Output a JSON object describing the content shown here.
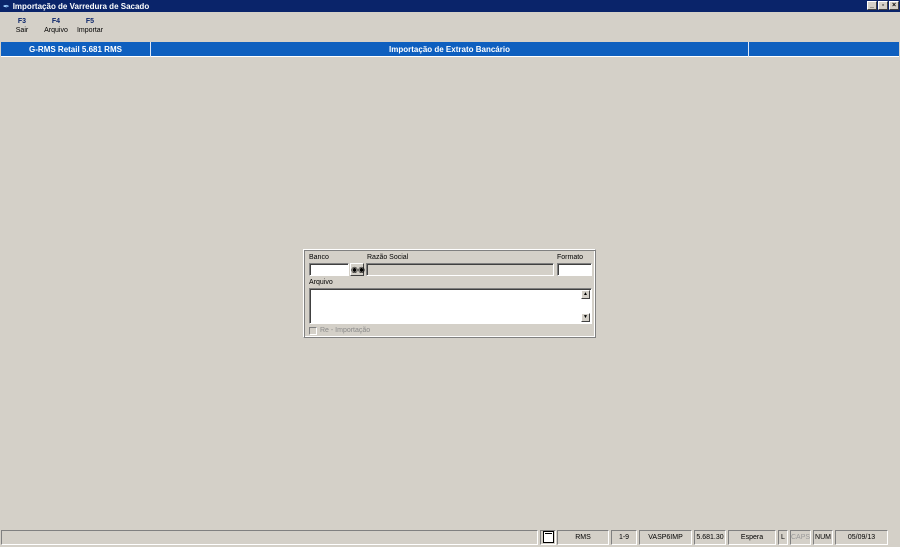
{
  "window": {
    "title": "Importação de Varredura de Sacado",
    "controls": {
      "minimize": "_",
      "restore": "▫",
      "close": "×"
    }
  },
  "toolbar": {
    "buttons": [
      {
        "key": "F3",
        "label": "Sair"
      },
      {
        "key": "F4",
        "label": "Arquivo"
      },
      {
        "key": "F5",
        "label": "Importar"
      }
    ]
  },
  "header": {
    "system": "G-RMS Retail 5.681 RMS",
    "screen_title": "Importação de Extrato Bancário",
    "right": ""
  },
  "form": {
    "banco": {
      "label": "Banco",
      "value": ""
    },
    "razao_social": {
      "label": "Razão Social",
      "value": ""
    },
    "formato": {
      "label": "Formato",
      "value": ""
    },
    "arquivo": {
      "label": "Arquivo",
      "value": ""
    },
    "reimportacao": {
      "label": "Re - Importação",
      "checked": false,
      "enabled": false
    }
  },
  "statusbar": {
    "message": "",
    "user": "RMS",
    "range": "1-9",
    "program": "VASP6IMP",
    "version": "5.681.30",
    "state": "Espera",
    "mode": "L",
    "caps": "CAPS",
    "num": "NUM",
    "date": "05/09/13"
  },
  "icons": {
    "app": "key-icon",
    "search": "binoculars-icon",
    "document": "document-icon"
  }
}
